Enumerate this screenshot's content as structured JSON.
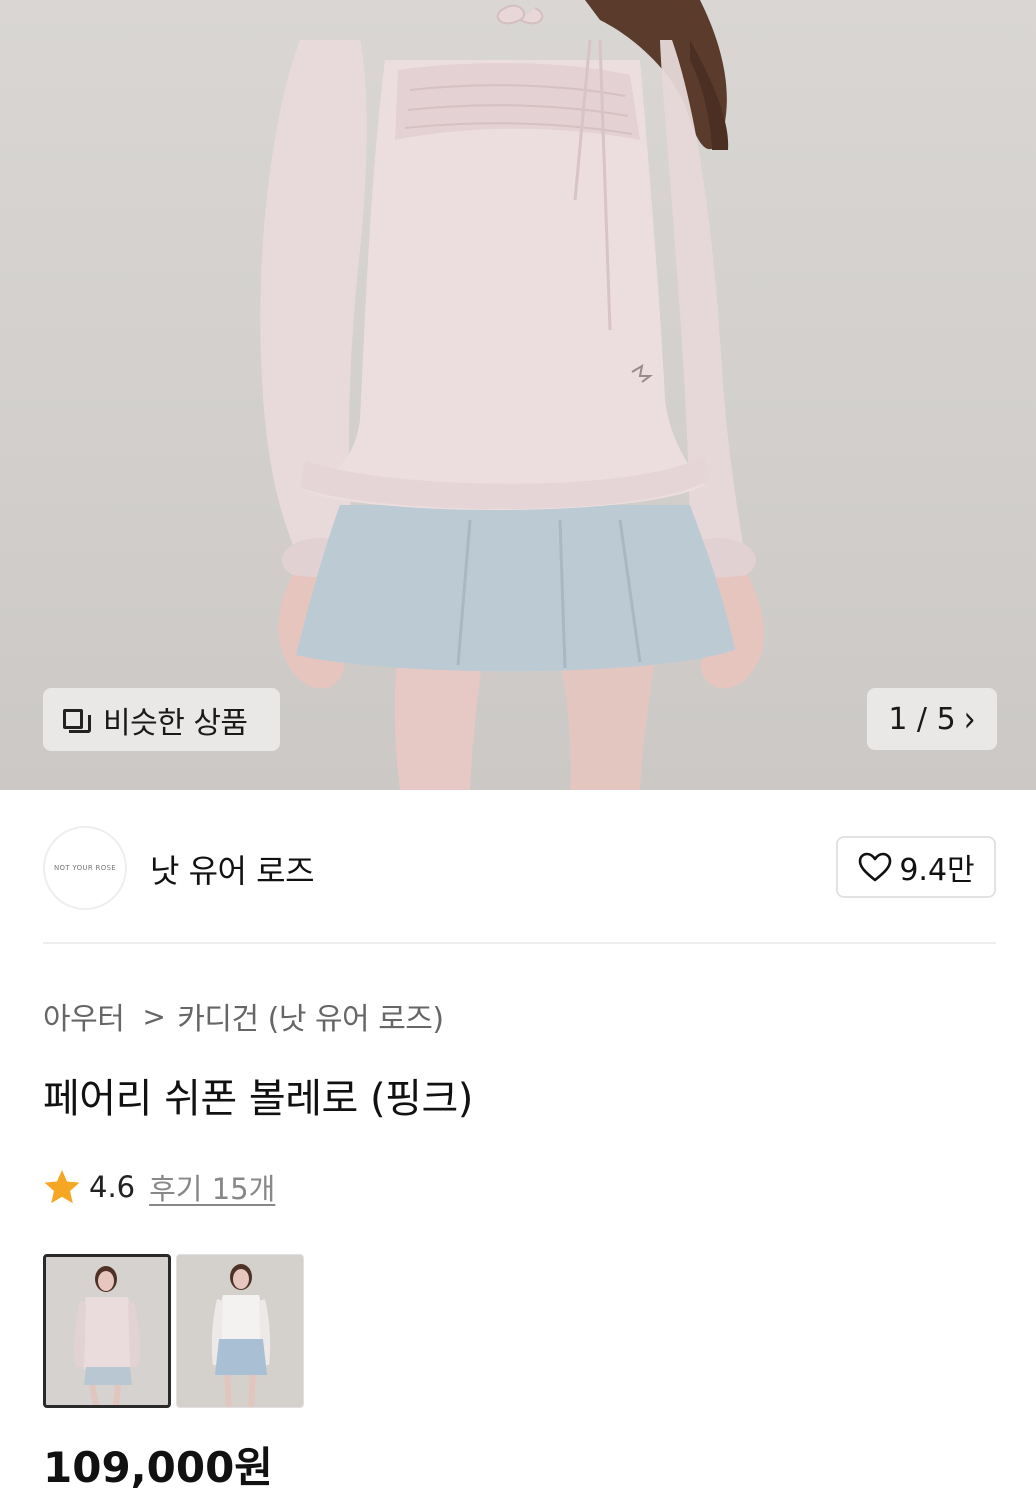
{
  "hero": {
    "similar_button_label": "비슷한 상품",
    "page_indicator": "1 / 5",
    "page_chevron": "›"
  },
  "brand": {
    "logo_text": "NOT YOUR ROSE",
    "name": "낫 유어 로즈",
    "like_count": "9.4만"
  },
  "product": {
    "breadcrumb": [
      "아우터",
      "카디건 (낫 유어 로즈)"
    ],
    "breadcrumb_separator": ">",
    "title": "페어리 쉬폰 볼레로 (핑크)",
    "rating": "4.6",
    "review_link": "후기 15개",
    "price": "109,000원"
  },
  "colors": {
    "star": "#f5a623",
    "hero_bg": "#d6d3d0",
    "top_pink": "#eadbdc",
    "skirt_blue": "#b9c8d3"
  }
}
